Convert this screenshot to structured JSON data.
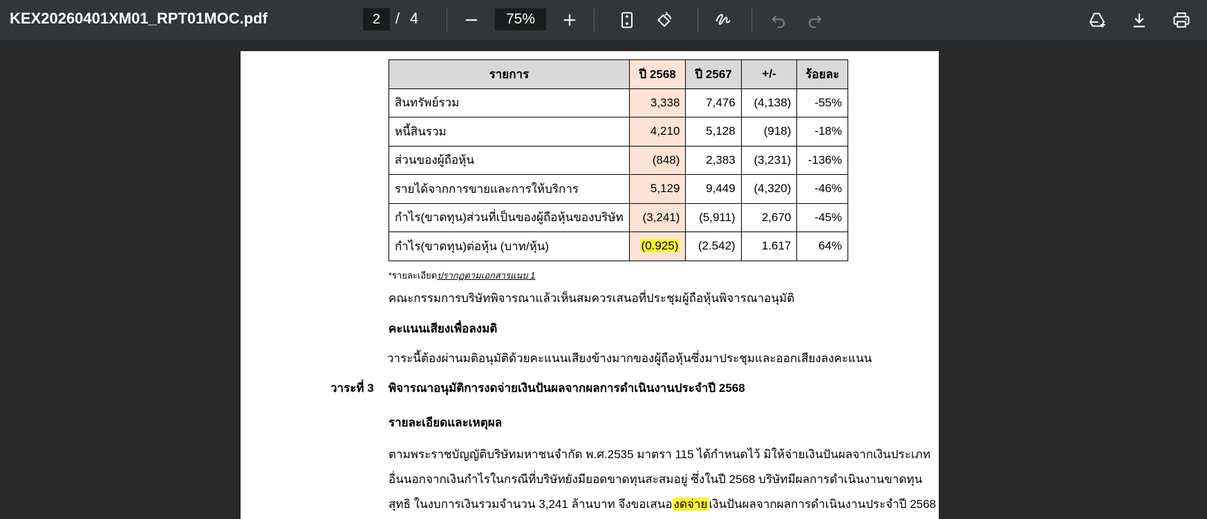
{
  "toolbar": {
    "file_name": "KEX20260401XM01_RPT01MOC.pdf",
    "page_current": "2",
    "page_separator": "/",
    "page_total": "4",
    "zoom": "75%",
    "icons": [
      "minus-icon",
      "plus-icon",
      "fit-page-icon",
      "rotate-icon",
      "draw-icon",
      "undo-icon",
      "redo-icon",
      "add-to-drive-icon",
      "download-icon",
      "print-icon"
    ]
  },
  "table": {
    "headers": [
      "รายการ",
      "ปี 2568",
      "ปี 2567",
      "+/-",
      "ร้อยละ"
    ],
    "rows": [
      {
        "item": "สินทรัพย์รวม",
        "y2568": "3,338",
        "y2567": "7,476",
        "diff": "(4,138)",
        "pct": "-55%"
      },
      {
        "item": "หนี้สินรวม",
        "y2568": "4,210",
        "y2567": "5,128",
        "diff": "(918)",
        "pct": "-18%"
      },
      {
        "item": "ส่วนของผู้ถือหุ้น",
        "y2568": "(848)",
        "y2567": "2,383",
        "diff": "(3,231)",
        "pct": "-136%"
      },
      {
        "item": "รายได้จากการขายและการให้บริการ",
        "y2568": "5,129",
        "y2567": "9,449",
        "diff": "(4,320)",
        "pct": "-46%"
      },
      {
        "item": "กำไร(ขาดทุน)ส่วนที่เป็นของผู้ถือหุ้นของบริษัท",
        "y2568": "(3,241)",
        "y2567": "(5,911)",
        "diff": "2,670",
        "pct": "-45%"
      },
      {
        "item": "กำไร(ขาดทุน)ต่อหุ้น (บาท/หุ้น)",
        "y2568": "(0.925)",
        "y2567": "(2.542)",
        "diff": "1.617",
        "pct": "64%"
      }
    ]
  },
  "doc": {
    "footnote_prefix": "*รายละเอียด",
    "footnote_link": "ปรากฏตามเอกสารแนบ 1",
    "board_text": "คณะกรรมการบริษัทพิจารณาแล้วเห็นสมควรเสนอที่ประชุมผู้ถือหุ้นพิจารณาอนุมัติ",
    "vote_heading": "คะแนนเสียงเพื่อลงมติ",
    "vote_text": "วาระนี้ต้องผ่านมติอนุมัติด้วยคะแนนเสียงข้างมากของผู้ถือหุ้นซึ่งมาประชุมและออกเสียงลงคะแนน",
    "agenda_number": "วาระที่ 3",
    "agenda_title": "พิจารณาอนุมัติการงดจ่ายเงินปันผลจากผลการดำเนินงานประจำปี 2568",
    "details_heading": "รายละเอียดและเหตุผล",
    "line1": "ตามพระราชบัญญัติบริษัทมหาชนจำกัด พ.ศ.2535 มาตรา 115 ได้กำหนดไว้ มิให้จ่ายเงินปันผลจากเงินประเภท",
    "line2": "อื่นนอกจากเงินกำไรในกรณีที่บริษัทยังมียอดขาดทุนสะสมอยู่ ซึ่งในปี 2568 บริษัทมีผลการดำเนินงานขาดทุน",
    "line3_pre": "สุทธิ ในงบการเงินรวมจำนวน 3,241 ล้านบาท จึงขอเสนอ",
    "line3_highlight": "งดจ่าย",
    "line3_post": "เงินปันผลจากผลการดำเนินงานประจำปี 2568"
  },
  "colors": {
    "toolbar_bg": "#323639",
    "viewer_bg": "#282828",
    "column_highlight": "#fbe4d5",
    "marker": "#fff32a"
  }
}
